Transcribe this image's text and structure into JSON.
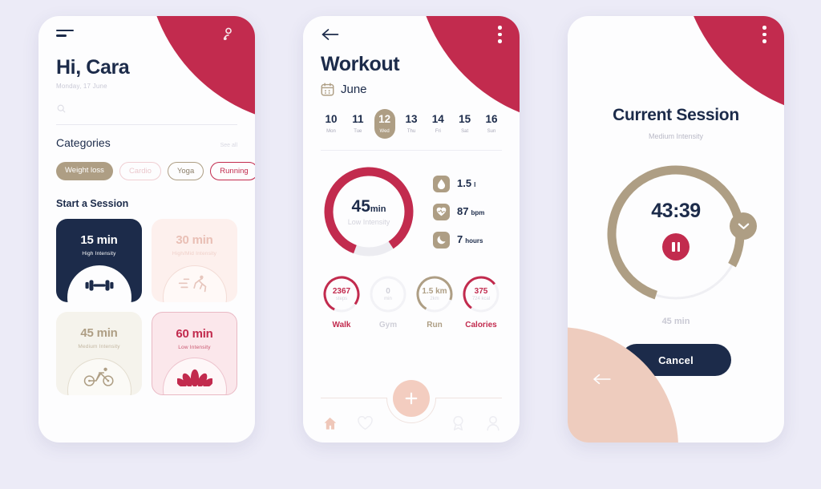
{
  "theme": {
    "crimson": "#C22B4E",
    "navy": "#1C2B4A",
    "tan": "#AE9E84",
    "peach": "#F3CDC0",
    "background": "#ECEBF7"
  },
  "screen_home": {
    "menu_icon": "hamburger-icon",
    "profile_icon": "user-icon",
    "greeting": "Hi, Cara",
    "date": "Monday, 17 June",
    "search_icon": "search-icon",
    "search_placeholder": "",
    "categories_title": "Categories",
    "see_all": "See all",
    "chips": [
      {
        "label": "Weight loss",
        "style": "fill-tan"
      },
      {
        "label": "Cardio",
        "style": "out-pink"
      },
      {
        "label": "Yoga",
        "style": "out-tan"
      },
      {
        "label": "Running",
        "style": "out-crim"
      }
    ],
    "start_title": "Start a Session",
    "cards": [
      {
        "time": "15 min",
        "intensity": "High Intensity",
        "icon": "dumbbell-icon",
        "style": "c-navy"
      },
      {
        "time": "30 min",
        "intensity": "High/Mid Intensity",
        "icon": "runner-icon",
        "style": "c-blush"
      },
      {
        "time": "45 min",
        "intensity": "Medium Intensity",
        "icon": "bicycle-icon",
        "style": "c-cream"
      },
      {
        "time": "60 min",
        "intensity": "Low Intensity",
        "icon": "lotus-icon",
        "style": "c-pink"
      }
    ]
  },
  "screen_workout": {
    "back_icon": "arrow-left-icon",
    "menu_icon": "kebab-menu-icon",
    "title": "Workout",
    "calendar_icon": "calendar-icon",
    "month": "June",
    "dates": [
      {
        "num": "10",
        "dow": "Mon",
        "active": false
      },
      {
        "num": "11",
        "dow": "Tue",
        "active": false
      },
      {
        "num": "12",
        "dow": "Wed",
        "active": true
      },
      {
        "num": "13",
        "dow": "Thu",
        "active": false
      },
      {
        "num": "14",
        "dow": "Fri",
        "active": false
      },
      {
        "num": "15",
        "dow": "Sat",
        "active": false
      },
      {
        "num": "16",
        "dow": "Sun",
        "active": false
      }
    ],
    "main_ring": {
      "value": "45",
      "unit": "min",
      "subtitle": "Low Intensity",
      "percent": 85
    },
    "stats": [
      {
        "icon": "water-drop-icon",
        "value": "1.5",
        "unit": "l"
      },
      {
        "icon": "heartbeat-icon",
        "value": "87",
        "unit": "bpm"
      },
      {
        "icon": "moon-icon",
        "value": "7",
        "unit": "hours"
      }
    ],
    "metrics": [
      {
        "name": "Walk",
        "value": "2367",
        "sub": "steps",
        "percent": 78,
        "color": "#C22B4E",
        "label_color": "#C22B4E"
      },
      {
        "name": "Gym",
        "value": "0",
        "sub": "min",
        "percent": 0,
        "color": "#EFEFF3",
        "label_color": "#CFCFD8"
      },
      {
        "name": "Run",
        "value": "1.5 km",
        "sub": "2km",
        "percent": 72,
        "color": "#AE9E84",
        "label_color": "#AE9E84"
      },
      {
        "name": "Calories",
        "value": "375",
        "sub": "724 kcal",
        "percent": 55,
        "color": "#C22B4E",
        "label_color": "#C22B4E"
      }
    ],
    "nav": [
      {
        "icon": "home-icon",
        "active": true
      },
      {
        "icon": "heart-icon",
        "active": false
      },
      {
        "icon": "plus-icon",
        "active": false
      },
      {
        "icon": "award-icon",
        "active": false
      },
      {
        "icon": "profile-icon",
        "active": false
      }
    ]
  },
  "screen_session": {
    "menu_icon": "kebab-menu-icon",
    "title": "Current Session",
    "subtitle": "Medium Intensity",
    "timer": "43:39",
    "ring_percent": 78,
    "handle_icon": "chevron-down-icon",
    "pause_icon": "pause-icon",
    "duration": "45  min",
    "cancel_label": "Cancel",
    "back_icon": "arrow-left-icon"
  }
}
